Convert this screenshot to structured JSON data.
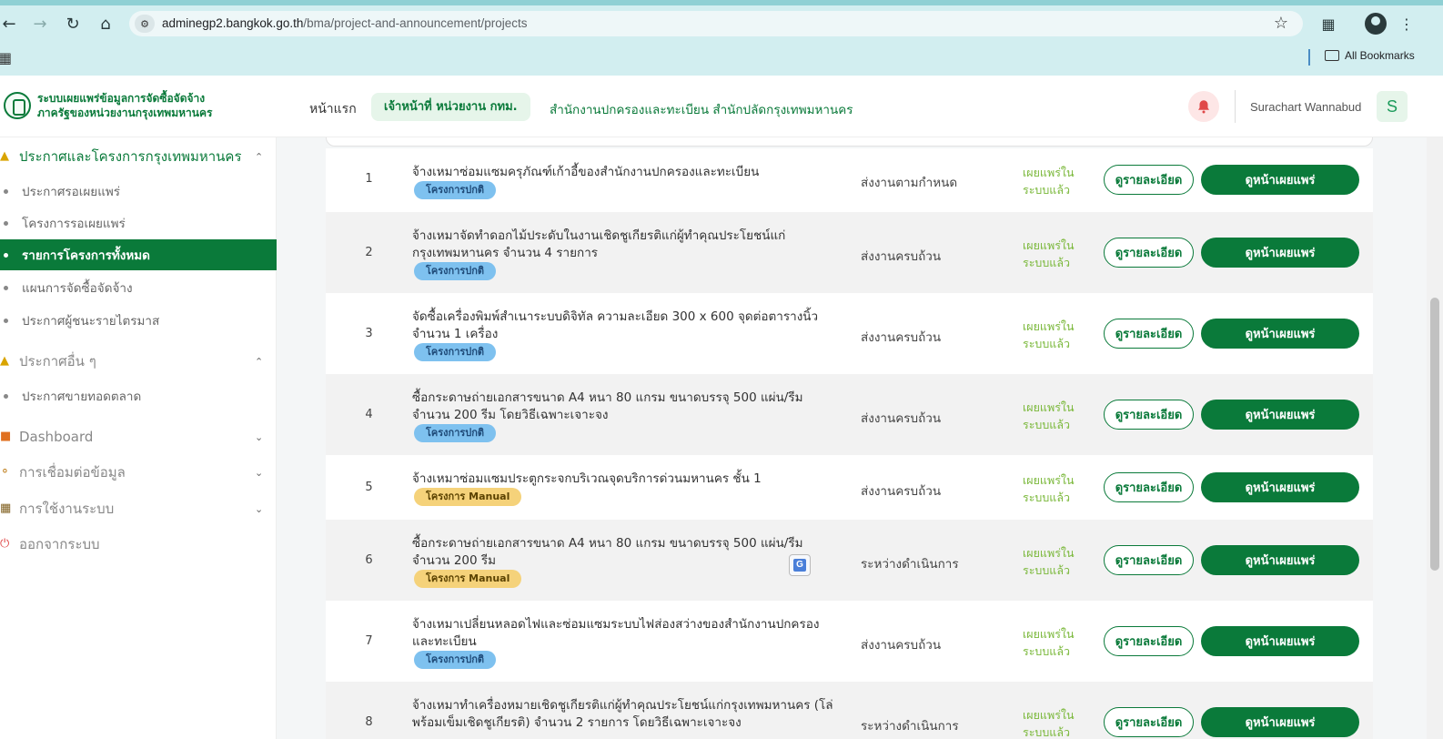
{
  "browser": {
    "url_host": "adminegp2.bangkok.go.th",
    "url_path": "/bma/project-and-announcement/projects",
    "bookmarks_label": "All Bookmarks"
  },
  "header": {
    "logo_line1": "ระบบเผยแพร่ข้อมูลการจัดซื้อจัดจ้าง",
    "logo_line2": "ภาครัฐของหน่วยงานกรุงเทพมหานคร",
    "home": "หน้าแรก",
    "role": "เจ้าหน้าที่ หน่วยงาน กทม.",
    "org": "สำนักงานปกครองและทะเบียน สำนักปลัดกรุงเทพมหานคร",
    "user_name": "Surachart Wannabud",
    "avatar_letter": "S"
  },
  "sidebar": {
    "section1": {
      "label": "ประกาศและโครงการกรุงเทพมหานคร",
      "items": [
        {
          "label": "ประกาศรอเผยแพร่"
        },
        {
          "label": "โครงการรอเผยแพร่"
        },
        {
          "label": "รายการโครงการทั้งหมด"
        },
        {
          "label": "แผนการจัดซื้อจัดจ้าง"
        },
        {
          "label": "ประกาศผู้ชนะรายไตรมาส"
        }
      ]
    },
    "section2": {
      "label": "ประกาศอื่น ๆ",
      "items": [
        {
          "label": "ประกาศขายทอดตลาด"
        }
      ]
    },
    "dashboard": "Dashboard",
    "connect": "การเชื่อมต่อข้อมูล",
    "usage": "การใช้งานระบบ",
    "logout": "ออกจากระบบ"
  },
  "table": {
    "detail_label": "ดูรายละเอียด",
    "publish_label": "ดูหน้าเผยแพร่",
    "rows": [
      {
        "no": "1",
        "title": "จ้างเหมาซ่อมแซมครุภัณฑ์เก้าอี้ของสำนักงานปกครองและทะเบียน",
        "badge": "โครงการปกติ",
        "status": "ส่งงานตามกำหนด",
        "published": "เผยแพร่ในระบบแล้ว"
      },
      {
        "no": "2",
        "title": "จ้างเหมาจัดทำดอกไม้ประดับในงานเชิดชูเกียรติแก่ผู้ทำคุณประโยชน์แก่กรุงเทพมหานคร จำนวน 4 รายการ",
        "badge": "โครงการปกติ",
        "status": "ส่งงานครบถ้วน",
        "published": "เผยแพร่ในระบบแล้ว"
      },
      {
        "no": "3",
        "title": "จัดซื้อเครื่องพิมพ์สำเนาระบบดิจิทัล ความละเอียด 300 x 600 จุดต่อตารางนิ้ว จำนวน 1 เครื่อง",
        "badge": "โครงการปกติ",
        "status": "ส่งงานครบถ้วน",
        "published": "เผยแพร่ในระบบแล้ว"
      },
      {
        "no": "4",
        "title": "ซื้อกระดาษถ่ายเอกสารขนาด A4 หนา 80 แกรม ขนาดบรรจุ 500 แผ่น/รีม จำนวน 200 รีม โดยวิธีเฉพาะเจาะจง",
        "badge": "โครงการปกติ",
        "status": "ส่งงานครบถ้วน",
        "published": "เผยแพร่ในระบบแล้ว"
      },
      {
        "no": "5",
        "title": "จ้างเหมาซ่อมแซมประตูกระจกบริเวณจุดบริการด่วนมหานคร ชั้น 1",
        "badge": "โครงการ Manual",
        "status": "ส่งงานครบถ้วน",
        "published": "เผยแพร่ในระบบแล้ว"
      },
      {
        "no": "6",
        "title": "ซื้อกระดาษถ่ายเอกสารขนาด A4 หนา 80 แกรม ขนาดบรรจุ 500 แผ่น/รีม จำนวน 200 รีม",
        "badge": "โครงการ Manual",
        "status": "ระหว่างดำเนินการ",
        "published": "เผยแพร่ในระบบแล้ว"
      },
      {
        "no": "7",
        "title": "จ้างเหมาเปลี่ยนหลอดไฟและซ่อมแซมระบบไฟส่องสว่างของสำนักงานปกครองและทะเบียน",
        "badge": "โครงการปกติ",
        "status": "ส่งงานครบถ้วน",
        "published": "เผยแพร่ในระบบแล้ว"
      },
      {
        "no": "8",
        "title": "จ้างเหมาทำเครื่องหมายเชิดชูเกียรติแก่ผู้ทำคุณประโยชน์แก่กรุงเทพมหานคร (โล่พร้อมเข็มเชิดชูเกียรติ) จำนวน 2 รายการ โดยวิธีเฉพาะเจาะจง",
        "badge": "",
        "status": "ระหว่างดำเนินการ",
        "published": "เผยแพร่ในระบบแล้ว"
      }
    ]
  },
  "colors": {
    "brand_green": "#0a7a3a",
    "published_green": "#7ab83a",
    "badge_normal": "#7ec1ef",
    "badge_manual": "#f5d27a"
  }
}
